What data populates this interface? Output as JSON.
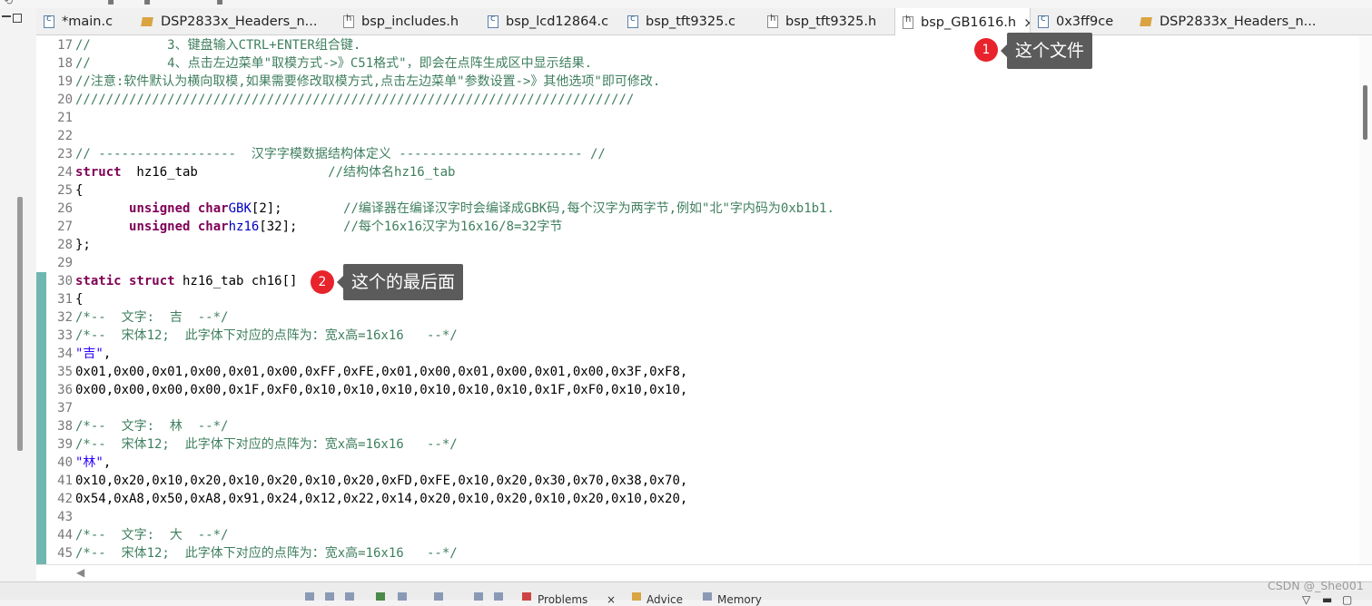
{
  "tabs": [
    {
      "label": "*main.c",
      "icon": "c-file-icon"
    },
    {
      "label": "DSP2833x_Headers_n...",
      "icon": "package-icon"
    },
    {
      "label": "bsp_includes.h",
      "icon": "h-file-icon"
    },
    {
      "label": "bsp_lcd12864.c",
      "icon": "c-file-icon"
    },
    {
      "label": "bsp_tft9325.c",
      "icon": "c-file-icon"
    },
    {
      "label": "bsp_tft9325.h",
      "icon": "h-file-icon"
    },
    {
      "label": "bsp_GB1616.h",
      "icon": "h-file-icon",
      "active": true
    },
    {
      "label": "0x3ff9ce",
      "icon": "c-file-icon"
    },
    {
      "label": "DSP2833x_Headers_n...",
      "icon": "package-icon"
    }
  ],
  "code_lines": [
    {
      "n": "17",
      "text": "//          3、键盘输入CTRL+ENTER组合键."
    },
    {
      "n": "18",
      "text": "//          4、点击左边菜单\"取模方式->》C51格式\"，即会在点阵生成区中显示结果."
    },
    {
      "n": "19",
      "text": "//注意:软件默认为横向取模,如果需要修改取模方式,点击左边菜单\"参数设置->》其他选项\"即可修改."
    },
    {
      "n": "20",
      "text": "/////////////////////////////////////////////////////////////////////////"
    },
    {
      "n": "21",
      "text": ""
    },
    {
      "n": "22",
      "text": ""
    },
    {
      "n": "23",
      "text": "// ------------------  汉字字模数据结构体定义 ------------------------ //"
    },
    {
      "n": "24",
      "kw": "struct",
      "text": "  hz16_tab                 ",
      "comment": "//结构体名hz16_tab"
    },
    {
      "n": "25",
      "text": "{"
    },
    {
      "n": "26",
      "indent": "       ",
      "kw": "unsigned char",
      "field": "GBK",
      "text": "[2];        ",
      "comment": "//编译器在编译汉字时会编译成GBK码,每个汉字为两字节,例如\"北\"字内码为0xb1b1."
    },
    {
      "n": "27",
      "indent": "       ",
      "kw": "unsigned char",
      "field": "hz16",
      "text": "[32];      ",
      "comment": "//每个16x16汉字为16x16/8=32字节"
    },
    {
      "n": "28",
      "text": "};"
    },
    {
      "n": "29",
      "text": ""
    },
    {
      "n": "30",
      "kw": "static struct",
      "text": " hz16_tab ch16[]"
    },
    {
      "n": "31",
      "text": "{"
    },
    {
      "n": "32",
      "comment": "/*--  文字:  吉  --*/"
    },
    {
      "n": "33",
      "comment": "/*--  宋体12;  此字体下对应的点阵为：宽x高=16x16   --*/"
    },
    {
      "n": "34",
      "string": "\"吉\"",
      "text": ","
    },
    {
      "n": "35",
      "text": "0x01,0x00,0x01,0x00,0x01,0x00,0xFF,0xFE,0x01,0x00,0x01,0x00,0x01,0x00,0x3F,0xF8,"
    },
    {
      "n": "36",
      "text": "0x00,0x00,0x00,0x00,0x1F,0xF0,0x10,0x10,0x10,0x10,0x10,0x10,0x1F,0xF0,0x10,0x10,"
    },
    {
      "n": "37",
      "text": ""
    },
    {
      "n": "38",
      "comment": "/*--  文字:  林  --*/"
    },
    {
      "n": "39",
      "comment": "/*--  宋体12;  此字体下对应的点阵为：宽x高=16x16   --*/"
    },
    {
      "n": "40",
      "string": "\"林\"",
      "text": ","
    },
    {
      "n": "41",
      "text": "0x10,0x20,0x10,0x20,0x10,0x20,0x10,0x20,0xFD,0xFE,0x10,0x20,0x30,0x70,0x38,0x70,"
    },
    {
      "n": "42",
      "text": "0x54,0xA8,0x50,0xA8,0x91,0x24,0x12,0x22,0x14,0x20,0x10,0x20,0x10,0x20,0x10,0x20,"
    },
    {
      "n": "43",
      "text": ""
    },
    {
      "n": "44",
      "comment": "/*--  文字:  大  --*/"
    },
    {
      "n": "45",
      "comment": "/*--  宋体12;  此字体下对应的点阵为：宽x高=16x16   --*/"
    }
  ],
  "annotations": [
    {
      "number": "1",
      "text": "这个文件"
    },
    {
      "number": "2",
      "text": "这个的最后面"
    }
  ],
  "bottom": {
    "tab1": "Problems",
    "tab2": "Advice",
    "tab3": "Memory"
  },
  "watermark": "CSDN @_She001",
  "colors": {
    "comment": "#3f7f5f",
    "keyword": "#7f0055",
    "string": "#2a00ff",
    "field": "#0000c0",
    "marker": "#e8232c",
    "callout": "#5b5b5b"
  }
}
